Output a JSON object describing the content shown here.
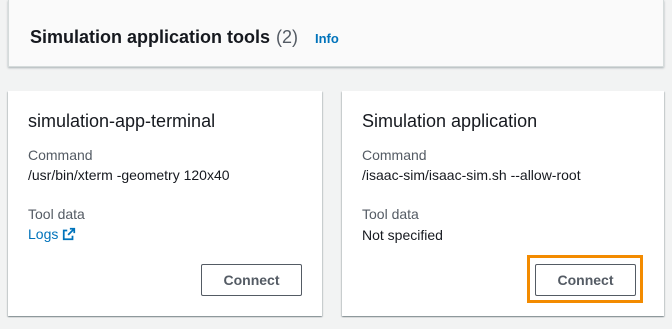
{
  "header": {
    "title": "Simulation application tools",
    "count": "(2)",
    "info_link": "Info"
  },
  "cards": [
    {
      "title": "simulation-app-terminal",
      "command_label": "Command",
      "command_value": "/usr/bin/xterm -geometry 120x40",
      "tool_data_label": "Tool data",
      "tool_data_value": "Logs",
      "tool_data_icon": "external-link-icon",
      "connect_label": "Connect"
    },
    {
      "title": "Simulation application",
      "command_label": "Command",
      "command_value": "/isaac-sim/isaac-sim.sh --allow-root",
      "tool_data_label": "Tool data",
      "tool_data_value": "Not specified",
      "connect_label": "Connect",
      "highlighted": true
    }
  ],
  "colors": {
    "link": "#0073bb",
    "highlight": "#f38b00",
    "background": "#f2f3f3"
  }
}
